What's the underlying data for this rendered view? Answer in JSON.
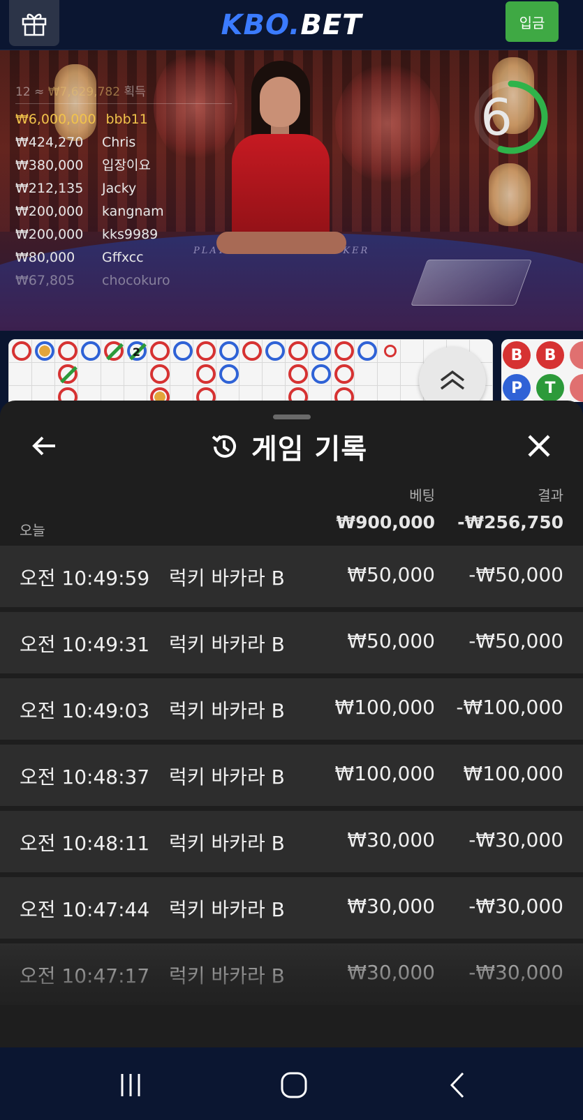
{
  "app": {
    "logo_part1": "KBO.",
    "logo_part2": "BET",
    "deposit_label": "입금",
    "gift_icon": "gift-icon"
  },
  "video": {
    "timer_value": "6",
    "timer_progress": 0.55,
    "table_label_player": "PLAYER",
    "table_label_banker": "BANKER",
    "winners_total_count": "12",
    "winners_total_amount": "₩7,629,782",
    "winners_total_suffix": "획득",
    "winners": [
      {
        "amount": "₩6,000,000",
        "name": "bbb11"
      },
      {
        "amount": "₩424,270",
        "name": "Chris"
      },
      {
        "amount": "₩380,000",
        "name": "입장이요"
      },
      {
        "amount": "₩212,135",
        "name": "Jacky"
      },
      {
        "amount": "₩200,000",
        "name": "kangnam"
      },
      {
        "amount": "₩200,000",
        "name": "kks9989"
      },
      {
        "amount": "₩80,000",
        "name": "Gffxcc"
      },
      {
        "amount": "₩67,805",
        "name": "chocokuro"
      }
    ]
  },
  "roadmap": {
    "tie_count": "2",
    "bt_buttons": [
      "B",
      "B",
      "P",
      "T"
    ]
  },
  "history": {
    "title": "게임 기록",
    "header_bet": "베팅",
    "header_result": "결과",
    "today_label": "오늘",
    "total_bet": "₩900,000",
    "total_result": "-₩256,750",
    "rows": [
      {
        "time": "오전 10:49:59",
        "game": "럭키 바카라 B",
        "bet": "₩50,000",
        "result": "-₩50,000"
      },
      {
        "time": "오전 10:49:31",
        "game": "럭키 바카라 B",
        "bet": "₩50,000",
        "result": "-₩50,000"
      },
      {
        "time": "오전 10:49:03",
        "game": "럭키 바카라 B",
        "bet": "₩100,000",
        "result": "-₩100,000"
      },
      {
        "time": "오전 10:48:37",
        "game": "럭키 바카라 B",
        "bet": "₩100,000",
        "result": "₩100,000"
      },
      {
        "time": "오전 10:48:11",
        "game": "럭키 바카라 B",
        "bet": "₩30,000",
        "result": "-₩30,000"
      },
      {
        "time": "오전 10:47:44",
        "game": "럭키 바카라 B",
        "bet": "₩30,000",
        "result": "-₩30,000"
      },
      {
        "time": "오전 10:47:17",
        "game": "럭키 바카라 B",
        "bet": "₩30,000",
        "result": "-₩30,000"
      }
    ]
  },
  "colors": {
    "brand_blue": "#3b7bff",
    "deposit_green": "#3fa944",
    "banker_red": "#d63232",
    "player_blue": "#2f62d6",
    "tie_green": "#2c9a3a",
    "winner_gold": "#f1c34b"
  }
}
